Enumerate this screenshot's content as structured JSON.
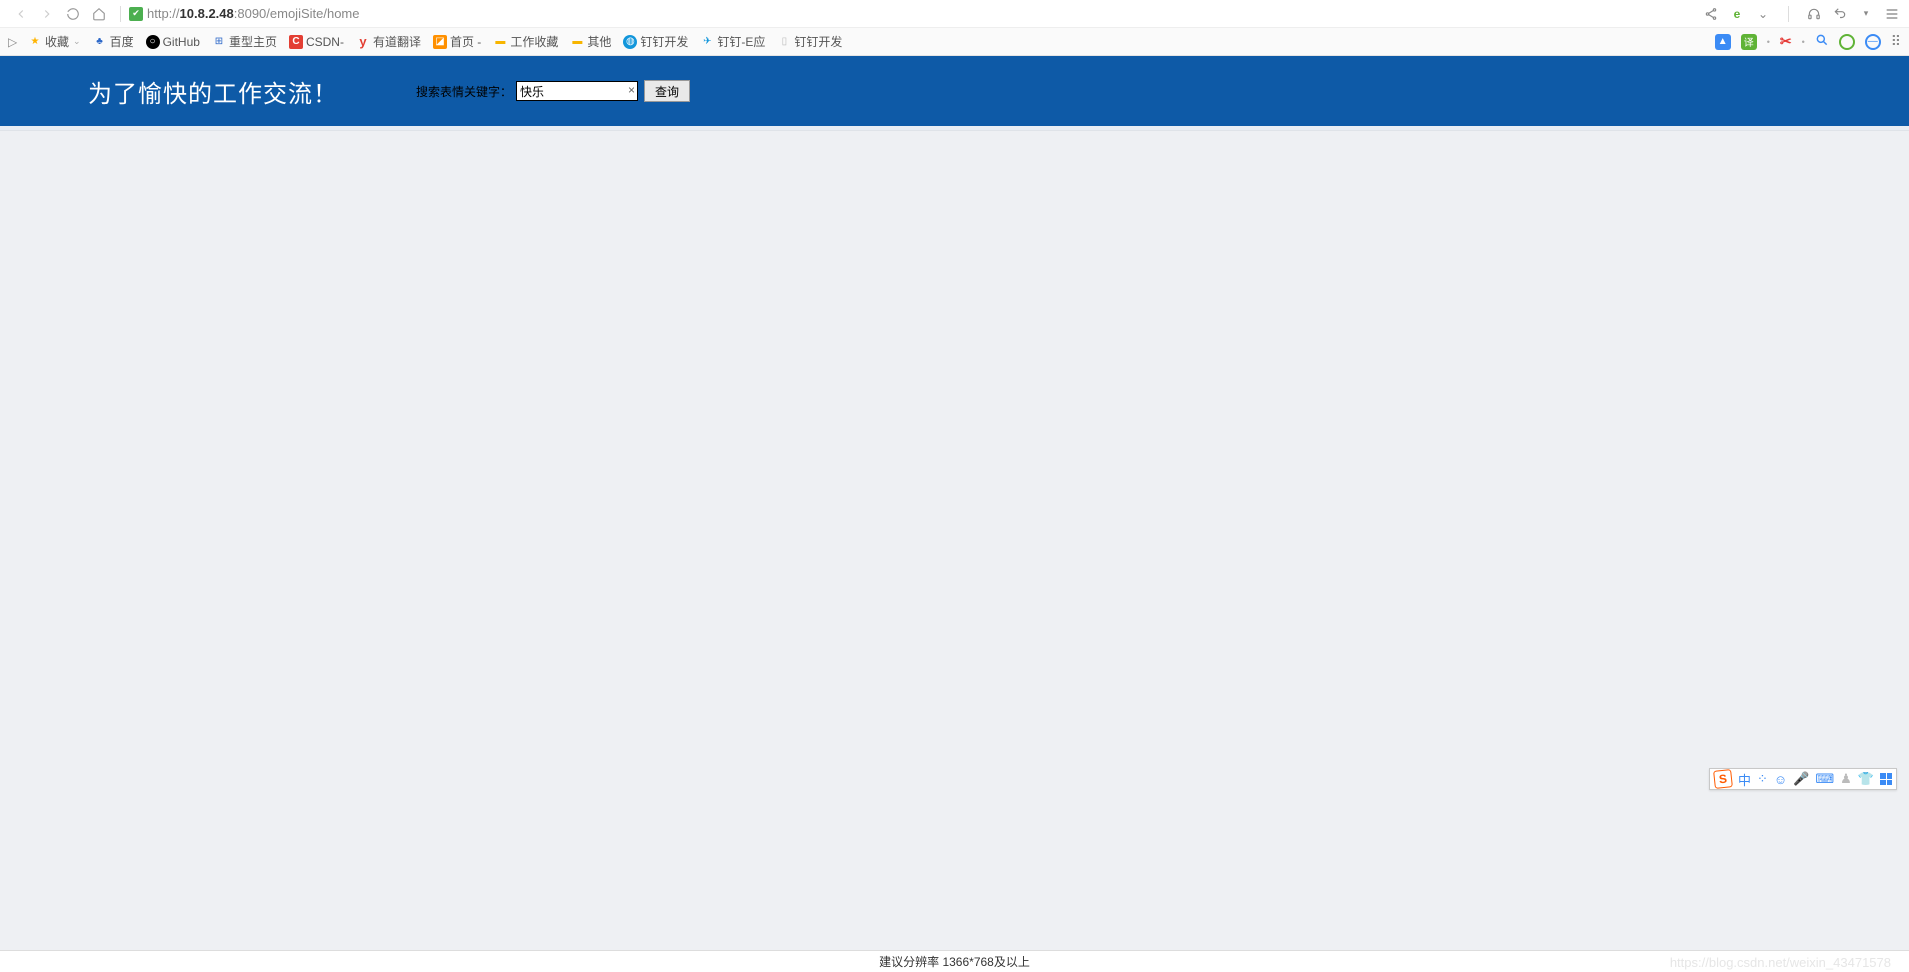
{
  "browser": {
    "url_prefix": "http://",
    "url_host": "10.8.2.48",
    "url_port_path": ":8090/emojiSite/home"
  },
  "bookmarks": {
    "fav_label": "收藏",
    "items": [
      {
        "label": "百度"
      },
      {
        "label": "GitHub"
      },
      {
        "label": "重型主页"
      },
      {
        "label": "CSDN-"
      },
      {
        "label": "有道翻译"
      },
      {
        "label": "首页 -"
      },
      {
        "label": "工作收藏"
      },
      {
        "label": "其他"
      },
      {
        "label": "钉钉开发"
      },
      {
        "label": "钉钉-E应"
      },
      {
        "label": "钉钉开发"
      }
    ]
  },
  "page": {
    "title": "为了愉快的工作交流！",
    "search_label": "搜索表情关键字：",
    "search_value": "快乐",
    "search_button": "查询"
  },
  "footer": {
    "text": "建议分辨率 1366*768及以上"
  },
  "ime": {
    "logo": "S",
    "lang": "中"
  },
  "watermark": "https://blog.csdn.net/weixin_43471578"
}
